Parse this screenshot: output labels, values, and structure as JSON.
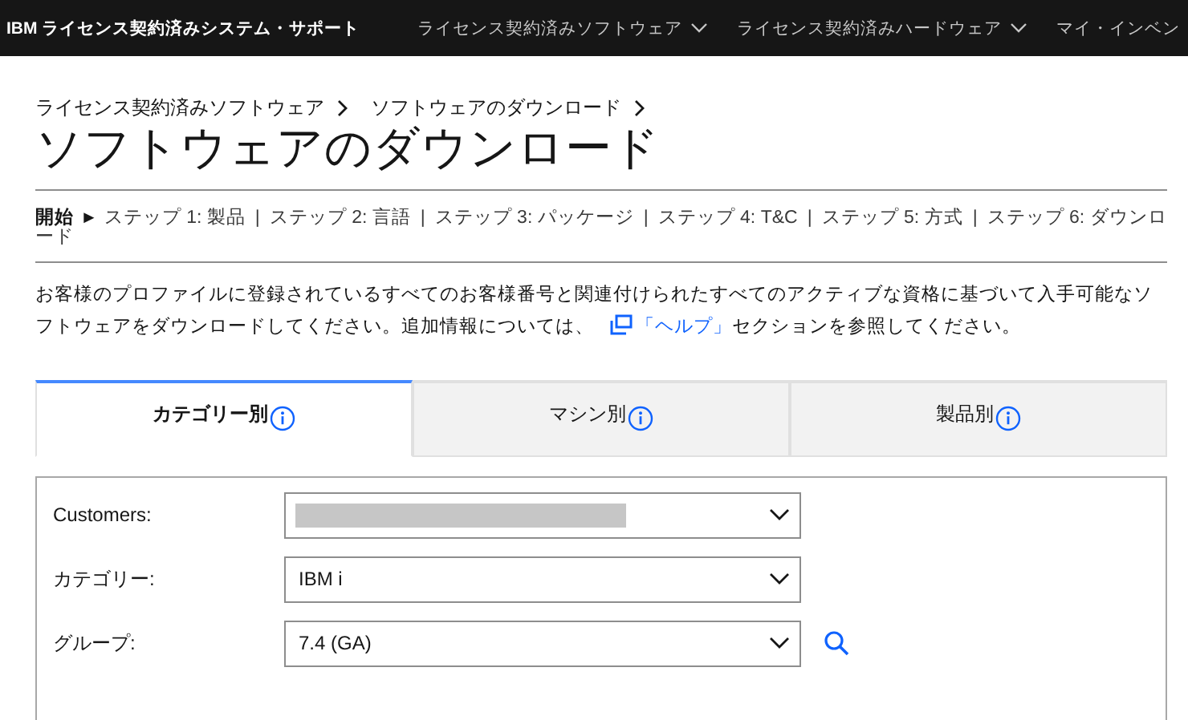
{
  "top_nav": {
    "brand": "IBM ライセンス契約済みシステム・サポート",
    "items": [
      {
        "label": "ライセンス契約済みソフトウェア",
        "dropdown": true
      },
      {
        "label": "ライセンス契約済みハードウェア",
        "dropdown": true
      },
      {
        "label": "マイ・インベン",
        "dropdown": false
      }
    ]
  },
  "breadcrumb": [
    "ライセンス契約済みソフトウェア",
    "ソフトウェアのダウンロード"
  ],
  "title": "ソフトウェアのダウンロード",
  "steps": {
    "start": "開始",
    "arrow": "►",
    "separator": "|",
    "items": [
      "ステップ 1: 製品",
      "ステップ 2: 言語",
      "ステップ 3: パッケージ",
      "ステップ 4: T&C",
      "ステップ 5: 方式",
      "ステップ 6: ダウンロード"
    ]
  },
  "intro": {
    "before": "お客様のプロファイルに登録されているすべてのお客様番号と関連付けられたすべてのアクティブな資格に基づいて入手可能なソフトウェアをダウンロードしてください。追加情報については、",
    "link": "「ヘルプ」",
    "after": "セクションを参照してください。"
  },
  "tabs": [
    {
      "label": "カテゴリー別",
      "selected": true
    },
    {
      "label": "マシン別",
      "selected": false
    },
    {
      "label": "製品別",
      "selected": false
    }
  ],
  "fields": [
    {
      "label": "Customers:",
      "redacted": true
    },
    {
      "label": "カテゴリー:",
      "value": "IBM i",
      "redacted": false
    },
    {
      "label": "グループ:",
      "value": "7.4 (GA)",
      "redacted": false
    }
  ]
}
